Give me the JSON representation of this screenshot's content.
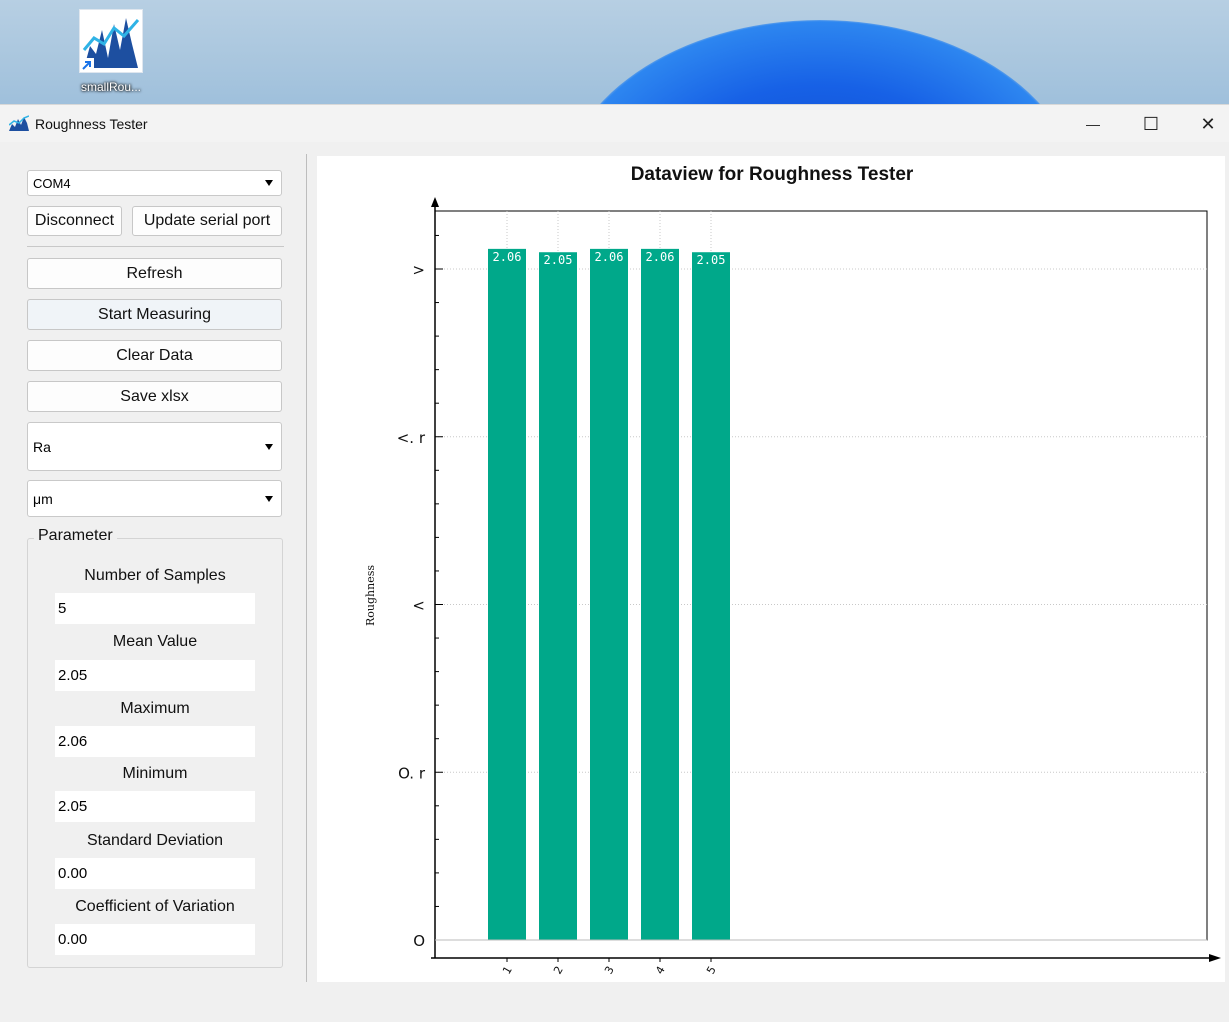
{
  "desktop": {
    "icon_label": "smallRou..."
  },
  "window": {
    "title": "Roughness Tester",
    "minimize_glyph": "—",
    "maximize_glyph": "☐",
    "close_glyph": "✕"
  },
  "left_panel": {
    "port_select": "COM4",
    "disconnect_label": "Disconnect",
    "update_port_label": "Update serial port",
    "refresh_label": "Refresh",
    "start_label": "Start Measuring",
    "clear_label": "Clear Data",
    "save_label": "Save xlsx",
    "param_select": "Ra",
    "unit_select": "μm"
  },
  "parameter": {
    "title": "Parameter",
    "fields": [
      {
        "label": "Number of Samples",
        "value": "5"
      },
      {
        "label": "Mean Value",
        "value": "2.05"
      },
      {
        "label": "Maximum",
        "value": "2.06"
      },
      {
        "label": "Minimum",
        "value": "2.05"
      },
      {
        "label": "Standard Deviation",
        "value": "0.00"
      },
      {
        "label": "Coefficient of Variation",
        "value": "0.00"
      }
    ]
  },
  "colors": {
    "bar": "#00a88a",
    "accent": "#0f46c8"
  },
  "chart_data": {
    "type": "bar",
    "title": "Dataview for Roughness Tester",
    "xlabel": "",
    "ylabel": "Roughness",
    "categories": [
      "1",
      "2",
      "3",
      "4",
      "5"
    ],
    "values": [
      2.06,
      2.05,
      2.06,
      2.06,
      2.05
    ],
    "data_labels": [
      "2.06",
      "2.05",
      "2.06",
      "2.06",
      "2.05"
    ],
    "ylim": [
      0,
      2.5
    ],
    "y_ticks": [
      0,
      0.5,
      1.0,
      1.5,
      2.0
    ],
    "y_tick_labels": [
      "O",
      "O. r",
      "<",
      "<. r",
      ">"
    ],
    "grid": true,
    "legend": "none"
  }
}
